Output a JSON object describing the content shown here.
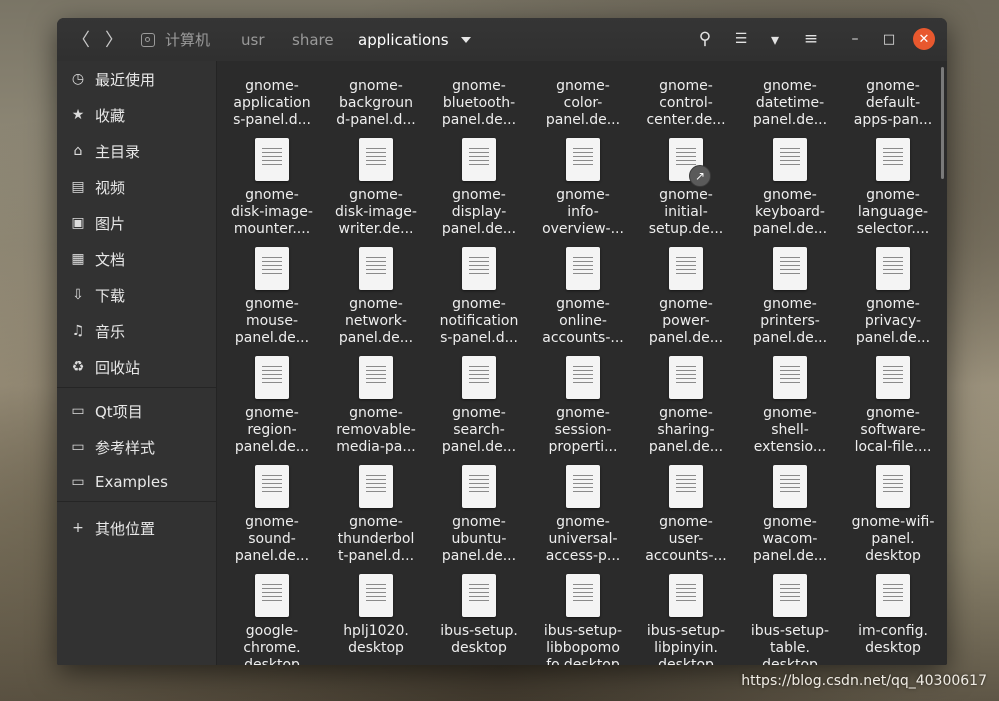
{
  "window": {
    "breadcrumbs": [
      {
        "label": "计算机",
        "icon": "computer-icon"
      },
      {
        "label": "usr"
      },
      {
        "label": "share"
      },
      {
        "label": "applications"
      }
    ]
  },
  "toolbar": {
    "back_icon": "〈",
    "forward_icon": "〉",
    "search_icon": "⚲",
    "list_view_icon": "☰",
    "view_options_icon": "▾",
    "menu_icon": "≡",
    "minimize_icon": "–",
    "maximize_icon": "□",
    "close_icon": "✕"
  },
  "sidebar": {
    "items": [
      {
        "label": "最近使用",
        "icon": "◷"
      },
      {
        "label": "收藏",
        "icon": "★"
      },
      {
        "label": "主目录",
        "icon": "⌂"
      },
      {
        "label": "视频",
        "icon": "▤"
      },
      {
        "label": "图片",
        "icon": "▣"
      },
      {
        "label": "文档",
        "icon": "▦"
      },
      {
        "label": "下载",
        "icon": "⇩"
      },
      {
        "label": "音乐",
        "icon": "♫"
      },
      {
        "label": "回收站",
        "icon": "♻"
      }
    ],
    "bookmarks": [
      {
        "label": "Qt项目",
        "icon": "▭"
      },
      {
        "label": "参考样式",
        "icon": "▭"
      },
      {
        "label": "Examples",
        "icon": "▭"
      }
    ],
    "other": {
      "label": "其他位置",
      "icon": "+"
    }
  },
  "files": [
    [
      "gnome-\napplication\ns-panel.d...",
      "gnome-\nbackgroun\nd-panel.d...",
      "gnome-\nbluetooth-\npanel.de...",
      "gnome-\ncolor-\npanel.de...",
      "gnome-\ncontrol-\ncenter.de...",
      "gnome-\ndatetime-\npanel.de...",
      "gnome-\ndefault-\napps-pan..."
    ],
    [
      "gnome-\ndisk-image-\nmounter....",
      "gnome-\ndisk-image-\nwriter.de...",
      "gnome-\ndisplay-\npanel.de...",
      "gnome-\ninfo-\noverview-...",
      "gnome-\ninitial-\nsetup.de...",
      "gnome-\nkeyboard-\npanel.de...",
      "gnome-\nlanguage-\nselector...."
    ],
    [
      "gnome-\nmouse-\npanel.de...",
      "gnome-\nnetwork-\npanel.de...",
      "gnome-\nnotification\ns-panel.d...",
      "gnome-\nonline-\naccounts-...",
      "gnome-\npower-\npanel.de...",
      "gnome-\nprinters-\npanel.de...",
      "gnome-\nprivacy-\npanel.de..."
    ],
    [
      "gnome-\nregion-\npanel.de...",
      "gnome-\nremovable-\nmedia-pa...",
      "gnome-\nsearch-\npanel.de...",
      "gnome-\nsession-\nproperti...",
      "gnome-\nsharing-\npanel.de...",
      "gnome-\nshell-\nextensio...",
      "gnome-\nsoftware-\nlocal-file...."
    ],
    [
      "gnome-\nsound-\npanel.de...",
      "gnome-\nthunderbol\nt-panel.d...",
      "gnome-\nubuntu-\npanel.de...",
      "gnome-\nuniversal-\naccess-p...",
      "gnome-\nuser-\naccounts-...",
      "gnome-\nwacom-\npanel.de...",
      "gnome-wifi-\npanel.\ndesktop"
    ],
    [
      "google-\nchrome.\ndesktop",
      "hplj1020.\ndesktop",
      "ibus-setup.\ndesktop",
      "ibus-setup-\nlibbopomo\nfo.desktop",
      "ibus-setup-\nlibpinyin.\ndesktop",
      "ibus-setup-\ntable.\ndesktop",
      "im-config.\ndesktop"
    ]
  ],
  "symlink_files": [
    "gnome-\ninitial-\nsetup.de..."
  ],
  "watermark": "https://blog.csdn.net/qq_40300617",
  "colors": {
    "titlebar": "#353535",
    "sidebar": "#323232",
    "content": "#2b2b2b",
    "close_button": "#e8582e"
  }
}
